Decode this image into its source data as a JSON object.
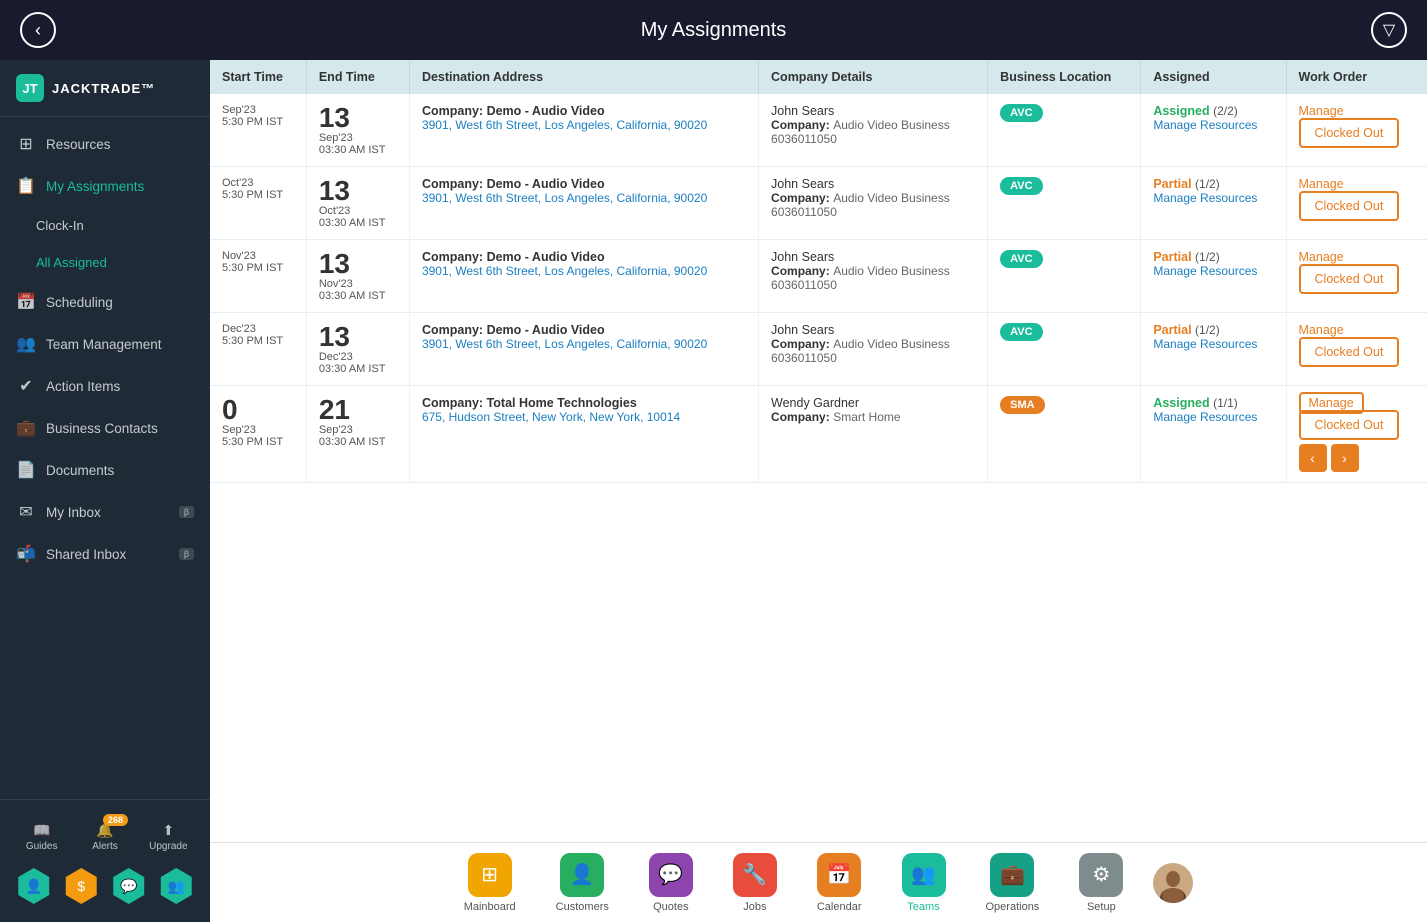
{
  "header": {
    "back_label": "‹",
    "title": "My Assignments",
    "filter_icon": "▽"
  },
  "sidebar": {
    "logo_text": "JACKTRADE™",
    "logo_abbr": "JT",
    "items": [
      {
        "id": "resources",
        "label": "Resources",
        "icon": "⊞"
      },
      {
        "id": "my-assignments",
        "label": "My Assignments",
        "icon": "📋",
        "active": true
      },
      {
        "id": "clock-in",
        "label": "Clock-In",
        "icon": "",
        "sub": true
      },
      {
        "id": "all-assigned",
        "label": "All Assigned",
        "icon": "",
        "sub": true,
        "subactive": true
      },
      {
        "id": "scheduling",
        "label": "Scheduling",
        "icon": "📅"
      },
      {
        "id": "team-management",
        "label": "Team Management",
        "icon": "👥"
      },
      {
        "id": "action-items",
        "label": "Action Items",
        "icon": "✔"
      },
      {
        "id": "business-contacts",
        "label": "Business Contacts",
        "icon": "💼"
      },
      {
        "id": "documents",
        "label": "Documents",
        "icon": "📄"
      },
      {
        "id": "my-inbox",
        "label": "My Inbox",
        "icon": "✉",
        "beta": "β"
      },
      {
        "id": "shared-inbox",
        "label": "Shared Inbox",
        "icon": "📬",
        "beta": "β"
      }
    ],
    "bottom_actions": [
      {
        "id": "guides",
        "label": "Guides",
        "icon": "📖"
      },
      {
        "id": "alerts",
        "label": "Alerts",
        "icon": "🔔",
        "badge": "268"
      },
      {
        "id": "upgrade",
        "label": "Upgrade",
        "icon": "⬆"
      }
    ],
    "hex_icons": [
      "👤",
      "$",
      "💬",
      "👥"
    ]
  },
  "table": {
    "columns": [
      "Start Time",
      "End Time",
      "Destination Address",
      "Company Details",
      "Business Location",
      "Assigned",
      "Work Order"
    ],
    "rows": [
      {
        "start_date_num": "",
        "start_date_label": "Sep'23",
        "start_time": "5:30 PM IST",
        "end_date_num": "13",
        "end_date_label": "Sep'23",
        "end_time": "03:30 AM IST",
        "company_label": "Company:",
        "company_name": "Demo - Audio Video",
        "address": "3901, West 6th Street, Los Angeles, California, 90020",
        "contact_name": "John Sears",
        "company_detail_label": "Company:",
        "company_detail": "Audio Video Business",
        "phone": "6036011050",
        "badge": "AVC",
        "badge_class": "badge-avc",
        "status": "Assigned",
        "status_class": "status-assigned",
        "status_count": "(2/2)",
        "manage_resources": "Manage Resources",
        "work_order": "Manage",
        "clocked_out": "Clocked Out",
        "has_nav": false
      },
      {
        "start_date_num": "",
        "start_date_label": "Oct'23",
        "start_time": "5:30 PM IST",
        "end_date_num": "13",
        "end_date_label": "Oct'23",
        "end_time": "03:30 AM IST",
        "company_label": "Company:",
        "company_name": "Demo - Audio Video",
        "address": "3901, West 6th Street, Los Angeles, California, 90020",
        "contact_name": "John Sears",
        "company_detail_label": "Company:",
        "company_detail": "Audio Video Business",
        "phone": "6036011050",
        "badge": "AVC",
        "badge_class": "badge-avc",
        "status": "Partial",
        "status_class": "status-partial",
        "status_count": "(1/2)",
        "manage_resources": "Manage Resources",
        "work_order": "Manage",
        "clocked_out": "Clocked Out",
        "has_nav": false
      },
      {
        "start_date_num": "",
        "start_date_label": "Nov'23",
        "start_time": "5:30 PM IST",
        "end_date_num": "13",
        "end_date_label": "Nov'23",
        "end_time": "03:30 AM IST",
        "company_label": "Company:",
        "company_name": "Demo - Audio Video",
        "address": "3901, West 6th Street, Los Angeles, California, 90020",
        "contact_name": "John Sears",
        "company_detail_label": "Company:",
        "company_detail": "Audio Video Business",
        "phone": "6036011050",
        "badge": "AVC",
        "badge_class": "badge-avc",
        "status": "Partial",
        "status_class": "status-partial",
        "status_count": "(1/2)",
        "manage_resources": "Manage Resources",
        "work_order": "Manage",
        "clocked_out": "Clocked Out",
        "has_nav": false
      },
      {
        "start_date_num": "",
        "start_date_label": "Dec'23",
        "start_time": "5:30 PM IST",
        "end_date_num": "13",
        "end_date_label": "Dec'23",
        "end_time": "03:30 AM IST",
        "company_label": "Company:",
        "company_name": "Demo - Audio Video",
        "address": "3901, West 6th Street, Los Angeles, California, 90020",
        "contact_name": "John Sears",
        "company_detail_label": "Company:",
        "company_detail": "Audio Video Business",
        "phone": "6036011050",
        "badge": "AVC",
        "badge_class": "badge-avc",
        "status": "Partial",
        "status_class": "status-partial",
        "status_count": "(1/2)",
        "manage_resources": "Manage Resources",
        "work_order": "Manage",
        "clocked_out": "Clocked Out",
        "has_nav": false
      },
      {
        "start_date_num": "0",
        "start_date_label": "Sep'23",
        "start_time": "5:30 PM IST",
        "end_date_num": "21",
        "end_date_label": "Sep'23",
        "end_time": "03:30 AM IST",
        "company_label": "Company:",
        "company_name": "Total Home Technologies",
        "address": "675, Hudson Street, New York, New York, 10014",
        "contact_name": "Wendy Gardner",
        "company_detail_label": "Company:",
        "company_detail": "Smart Home",
        "phone": "",
        "badge": "SMA",
        "badge_class": "badge-sma",
        "status": "Assigned",
        "status_class": "status-assigned",
        "status_count": "(1/1)",
        "manage_resources": "Manage Resources",
        "work_order": "Manage",
        "work_order_highlighted": true,
        "clocked_out": "Clocked Out",
        "has_nav": true
      }
    ]
  },
  "bottom_nav": {
    "items": [
      {
        "id": "mainboard",
        "label": "Mainboard",
        "icon": "⊞",
        "color": "nav-icon-yellow"
      },
      {
        "id": "customers",
        "label": "Customers",
        "icon": "👤",
        "color": "nav-icon-green"
      },
      {
        "id": "quotes",
        "label": "Quotes",
        "icon": "💬",
        "color": "nav-icon-purple"
      },
      {
        "id": "jobs",
        "label": "Jobs",
        "icon": "🔧",
        "color": "nav-icon-red"
      },
      {
        "id": "calendar",
        "label": "Calendar",
        "icon": "📅",
        "color": "nav-icon-orange2"
      },
      {
        "id": "teams",
        "label": "Teams",
        "icon": "👥",
        "color": "nav-icon-teal",
        "active": true
      },
      {
        "id": "operations",
        "label": "Operations",
        "icon": "💼",
        "color": "nav-icon-teal-dark"
      },
      {
        "id": "setup",
        "label": "Setup",
        "icon": "⚙",
        "color": "nav-icon-gray"
      }
    ]
  }
}
